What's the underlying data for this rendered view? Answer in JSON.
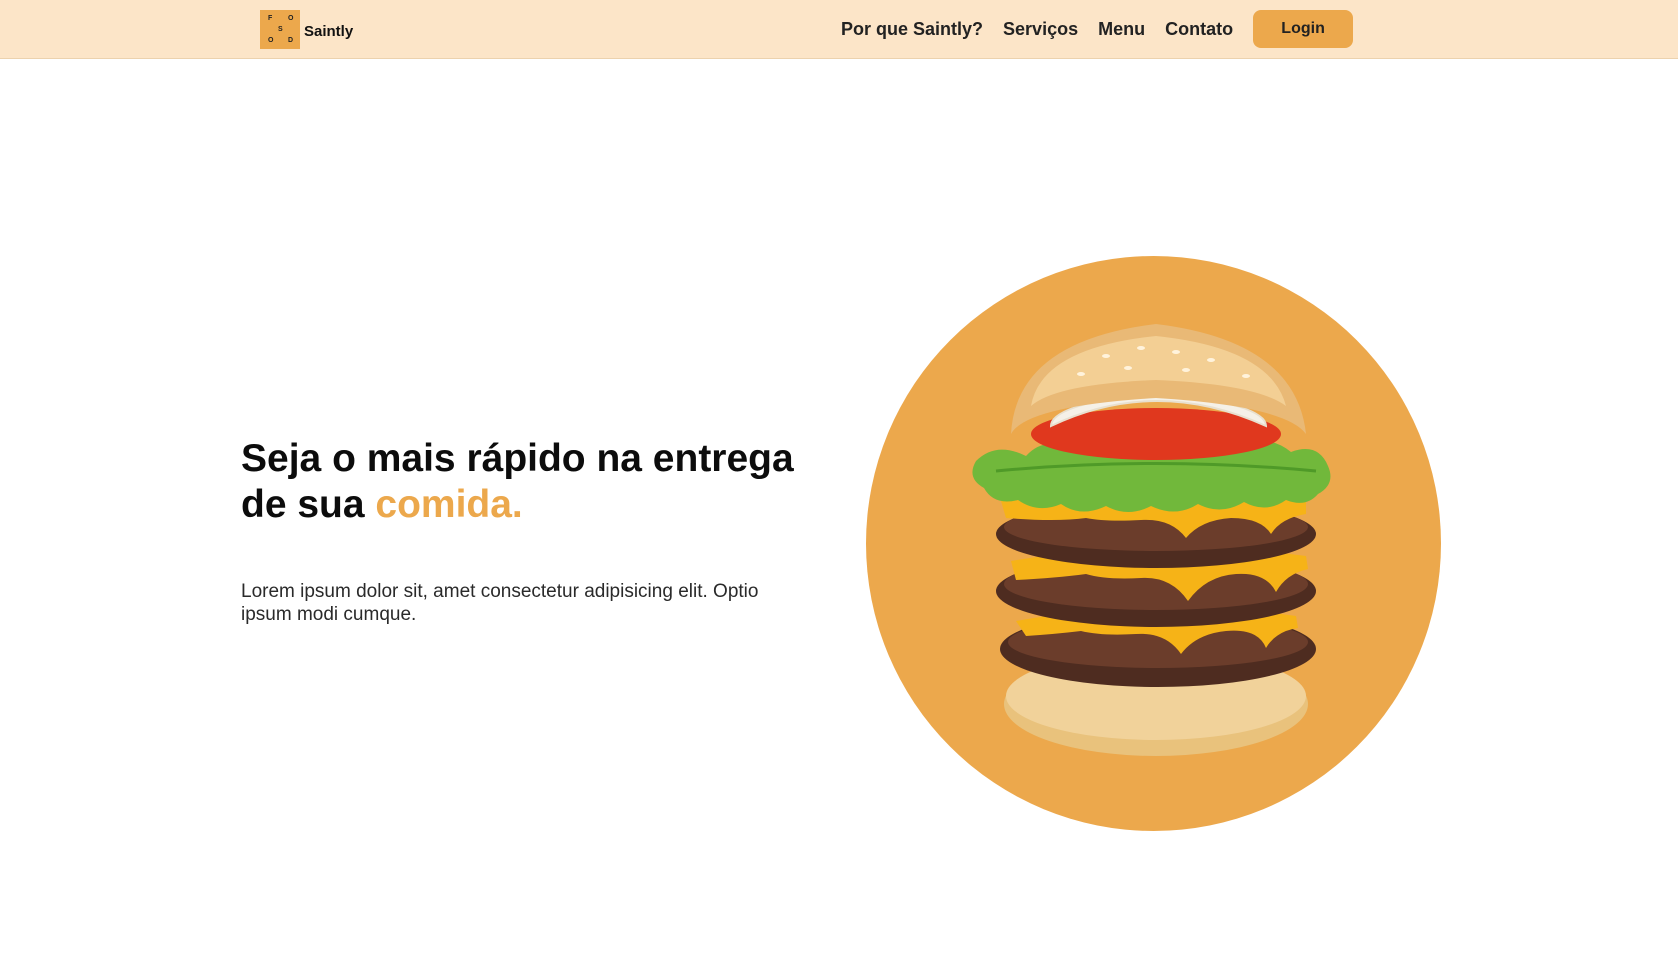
{
  "brand": {
    "logo_letters": [
      "F",
      "O",
      "S",
      "O",
      "D"
    ],
    "name": "Saintly"
  },
  "nav": {
    "items": [
      {
        "label": "Por que Saintly?"
      },
      {
        "label": "Serviços"
      },
      {
        "label": "Menu"
      },
      {
        "label": "Contato"
      }
    ],
    "login_label": "Login"
  },
  "hero": {
    "title_main": "Seja o mais rápido na entrega de sua ",
    "title_accent": "comida.",
    "text": "Lorem ipsum dolor sit, amet consectetur adipisicing elit. Optio ipsum modi cumque.",
    "image_subject": "burger-image"
  },
  "colors": {
    "nav_background": "#fce5c8",
    "accent": "#eca84c",
    "text": "#0c0c0c"
  }
}
